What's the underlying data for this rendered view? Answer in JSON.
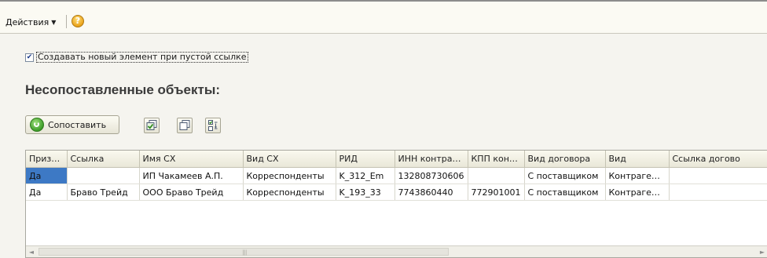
{
  "toolbar": {
    "actions_label": "Действия",
    "help_symbol": "?"
  },
  "checkbox": {
    "checked": true,
    "check_mark": "✔",
    "label": "Создавать новый элемент при пустой ссылке"
  },
  "section_title": "Несопоставленные объекты",
  "section_title_suffix": ":",
  "match_button": {
    "label": "Сопоставить"
  },
  "table": {
    "columns": [
      "Призна...",
      "Ссылка",
      "Имя СХ",
      "Вид СХ",
      "РИД",
      "ИНН контраге...",
      "КПП конт...",
      "Вид договора",
      "Вид",
      "Ссылка догово"
    ],
    "rows": [
      [
        "Да",
        "",
        "ИП Чакамеев А.П.",
        "Корреспонденты",
        "K_312_Em",
        "132808730606",
        "",
        "С поставщиком",
        "Контрагенты",
        ""
      ],
      [
        "Да",
        "Браво Трейд",
        "ООО Браво Трейд",
        "Корреспонденты",
        "K_193_33",
        "7743860440",
        "772901001",
        "С поставщиком",
        "Контрагенты",
        ""
      ]
    ],
    "selected_cell": [
      0,
      0
    ]
  },
  "scrollbar": {
    "left_arrow": "◄",
    "right_arrow": "►",
    "grip": "||||"
  },
  "colors": {
    "selection": "#3d79c5",
    "header": "#e9e7d8",
    "background": "#f5f4ef"
  }
}
